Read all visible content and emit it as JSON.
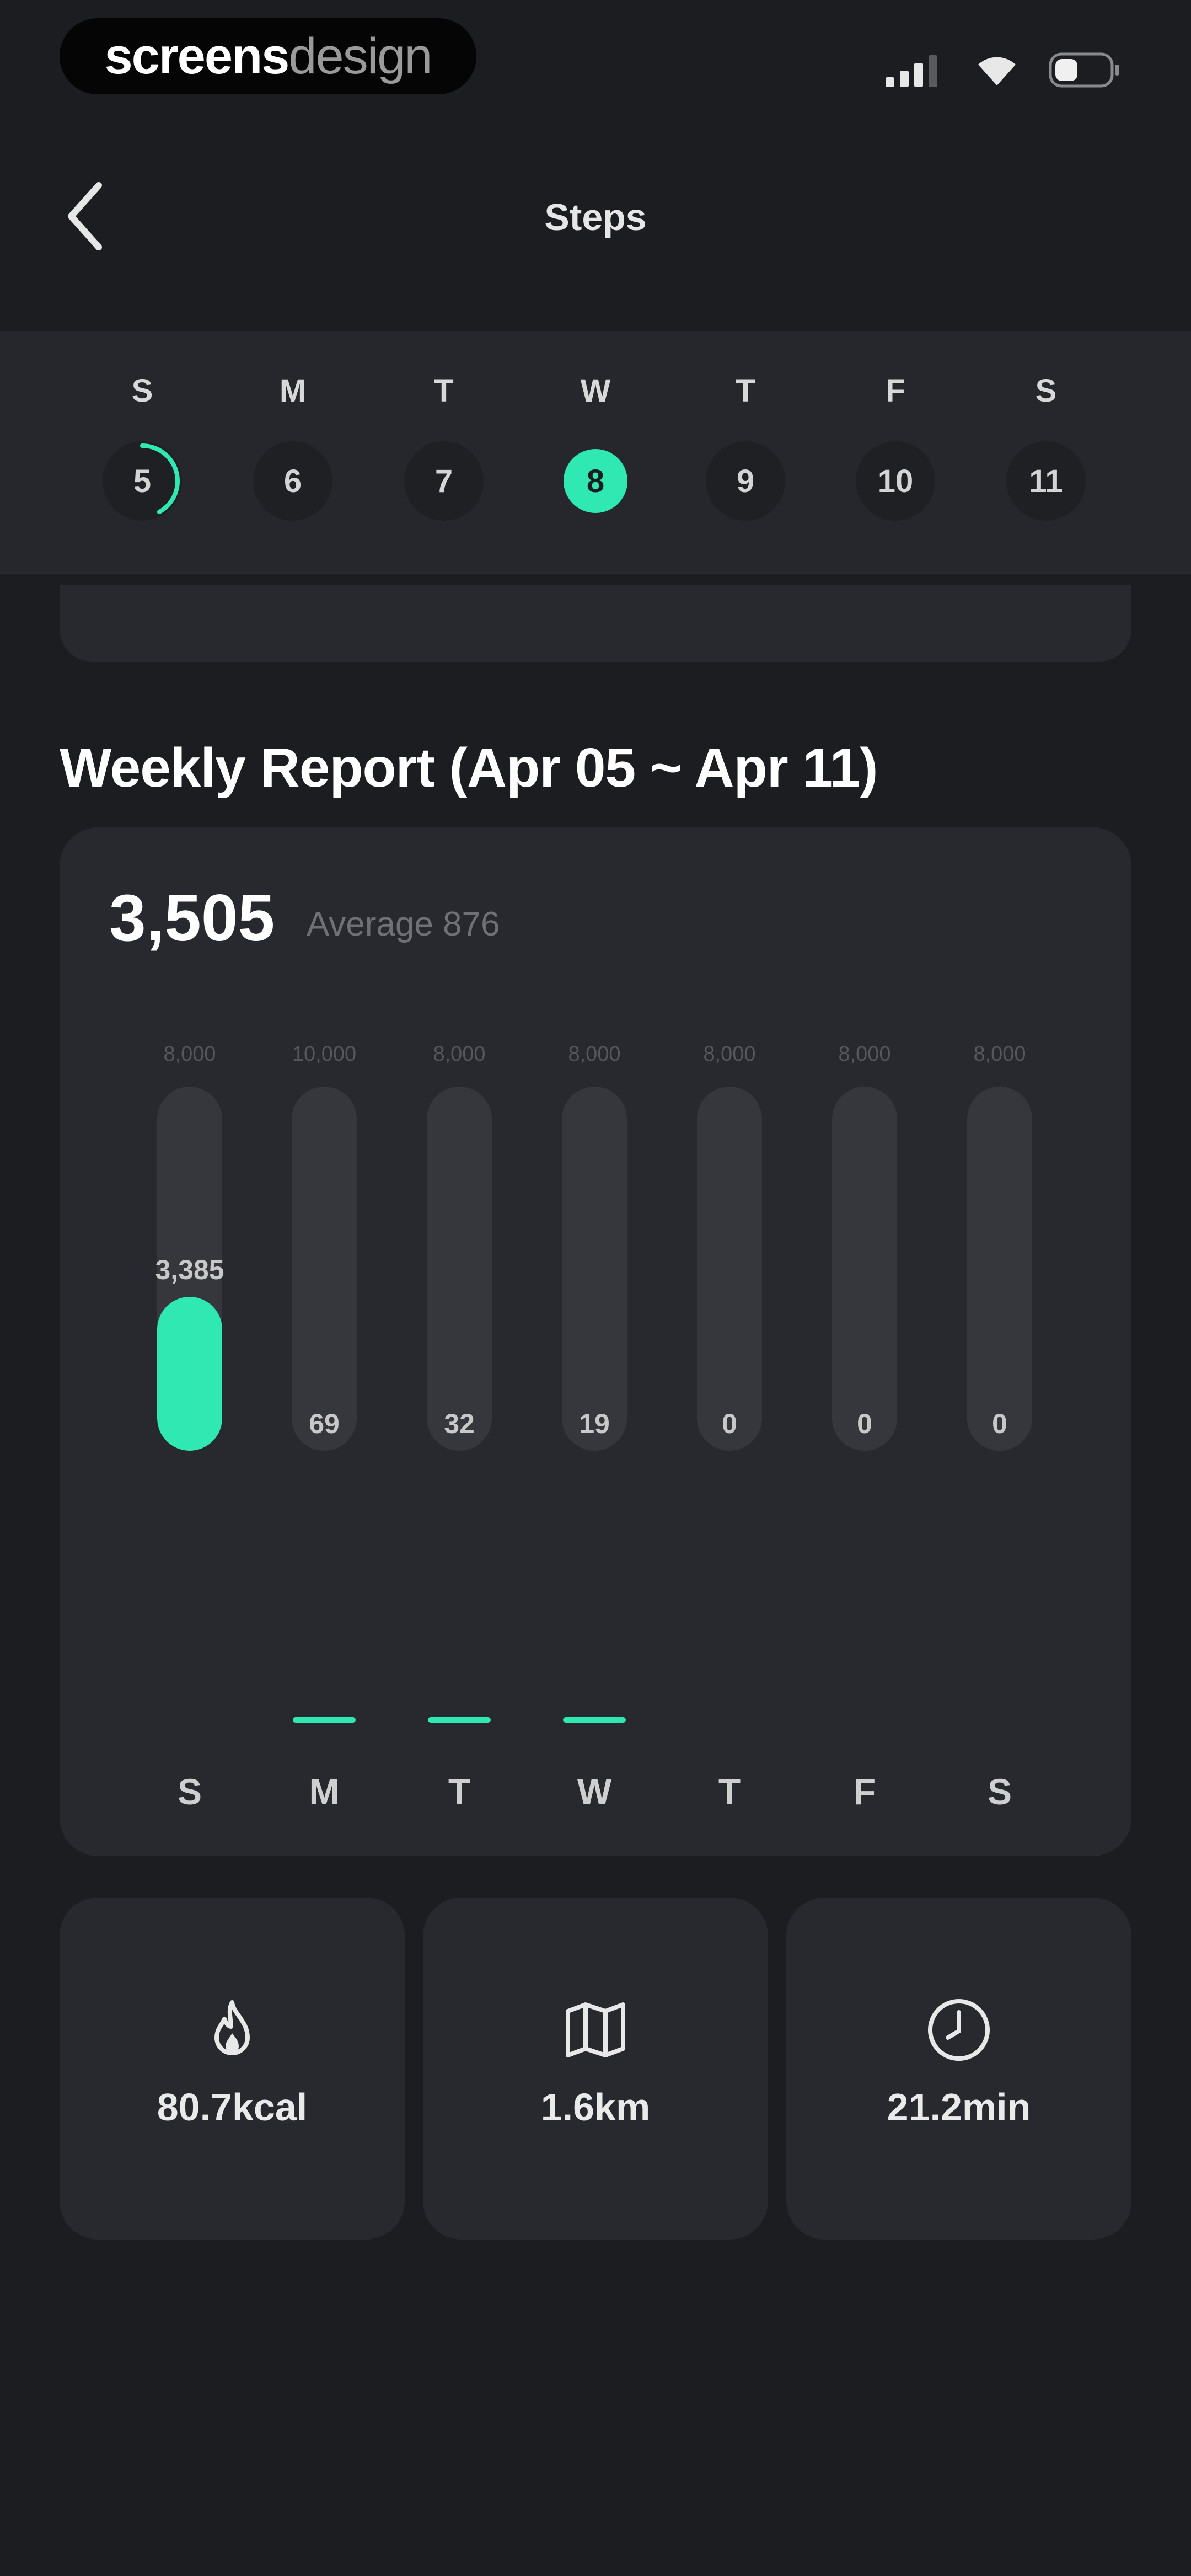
{
  "status_bar": {
    "brand_bold": "screens",
    "brand_light": "design",
    "icons": [
      "signal-icon",
      "wifi-icon",
      "battery-icon"
    ]
  },
  "nav": {
    "title": "Steps",
    "back_icon": "chevron-left-icon"
  },
  "week": {
    "days": [
      {
        "dow": "S",
        "date": "5"
      },
      {
        "dow": "M",
        "date": "6"
      },
      {
        "dow": "T",
        "date": "7"
      },
      {
        "dow": "W",
        "date": "8"
      },
      {
        "dow": "T",
        "date": "9"
      },
      {
        "dow": "F",
        "date": "10"
      },
      {
        "dow": "S",
        "date": "11"
      }
    ],
    "selected_index": 3,
    "progress_day_index": 0,
    "progress_fraction": 0.42
  },
  "weekly_report": {
    "title": "Weekly Report (Apr 05 ~ Apr 11)",
    "total": "3,505",
    "average_label": "Average 876"
  },
  "chart_data": {
    "type": "bar",
    "categories": [
      "S",
      "M",
      "T",
      "W",
      "T",
      "F",
      "S"
    ],
    "values": [
      3385,
      69,
      32,
      19,
      0,
      0,
      0
    ],
    "value_labels": [
      "3,385",
      "69",
      "32",
      "19",
      "0",
      "0",
      "0"
    ],
    "goal_labels": [
      "8,000",
      "10,000",
      "8,000",
      "8,000",
      "8,000",
      "8,000",
      "8,000"
    ],
    "goals": [
      8000,
      10000,
      8000,
      8000,
      8000,
      8000,
      8000
    ],
    "accent_color": "#2fe8b2",
    "track_color": "#36373c"
  },
  "stats": [
    {
      "icon": "flame-icon",
      "value": "80.7kcal"
    },
    {
      "icon": "map-icon",
      "value": "1.6km"
    },
    {
      "icon": "clock-icon",
      "value": "21.2min"
    }
  ],
  "colors": {
    "background": "#1c1d21",
    "card": "#28292e",
    "accent": "#2fe8b2"
  }
}
